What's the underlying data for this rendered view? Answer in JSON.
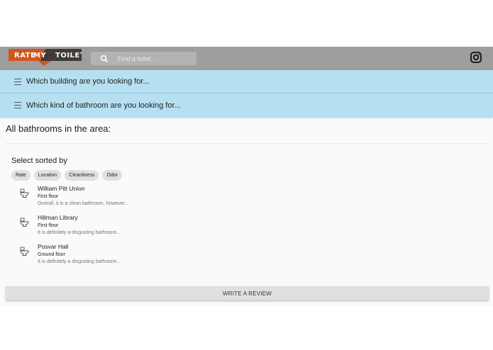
{
  "logo": {
    "word1": "RATE",
    "word2": "MY",
    "word3": "TOILET"
  },
  "search": {
    "placeholder": "Find a toilet..."
  },
  "header": {
    "social_icon": "instagram-icon"
  },
  "menus": [
    {
      "label": "Which building are you looking for...",
      "icon": "menu-icon"
    },
    {
      "label": "Which kind of bathroom are you looking for...",
      "icon": "menu-icon"
    }
  ],
  "main": {
    "heading": "All bathrooms in the area:",
    "sort_title": "Select sorted by",
    "sort_options": [
      "Rate",
      "Location",
      "Cleanliness",
      "Odor"
    ],
    "bathrooms": [
      {
        "name": "William Pitt Union",
        "floor": "First floor",
        "review": "Overall, it is a clean bathroom, however...",
        "icon": "toilet-icon"
      },
      {
        "name": "Hillman Library",
        "floor": "First floor",
        "review": "It is definitely a disgusting bathroom...",
        "icon": "toilet-icon"
      },
      {
        "name": "Posvar Hall",
        "floor": "Ground floor",
        "review": "It is definitely a disgusting bathroom...",
        "icon": "toilet-icon"
      }
    ],
    "write_review_label": "WRITE A REVIEW"
  },
  "colors": {
    "header_bg": "#9e9e9e",
    "menu_bg": "#b6e0f1",
    "logo_orange": "#d1561e",
    "logo_dark": "#3e3b38"
  }
}
